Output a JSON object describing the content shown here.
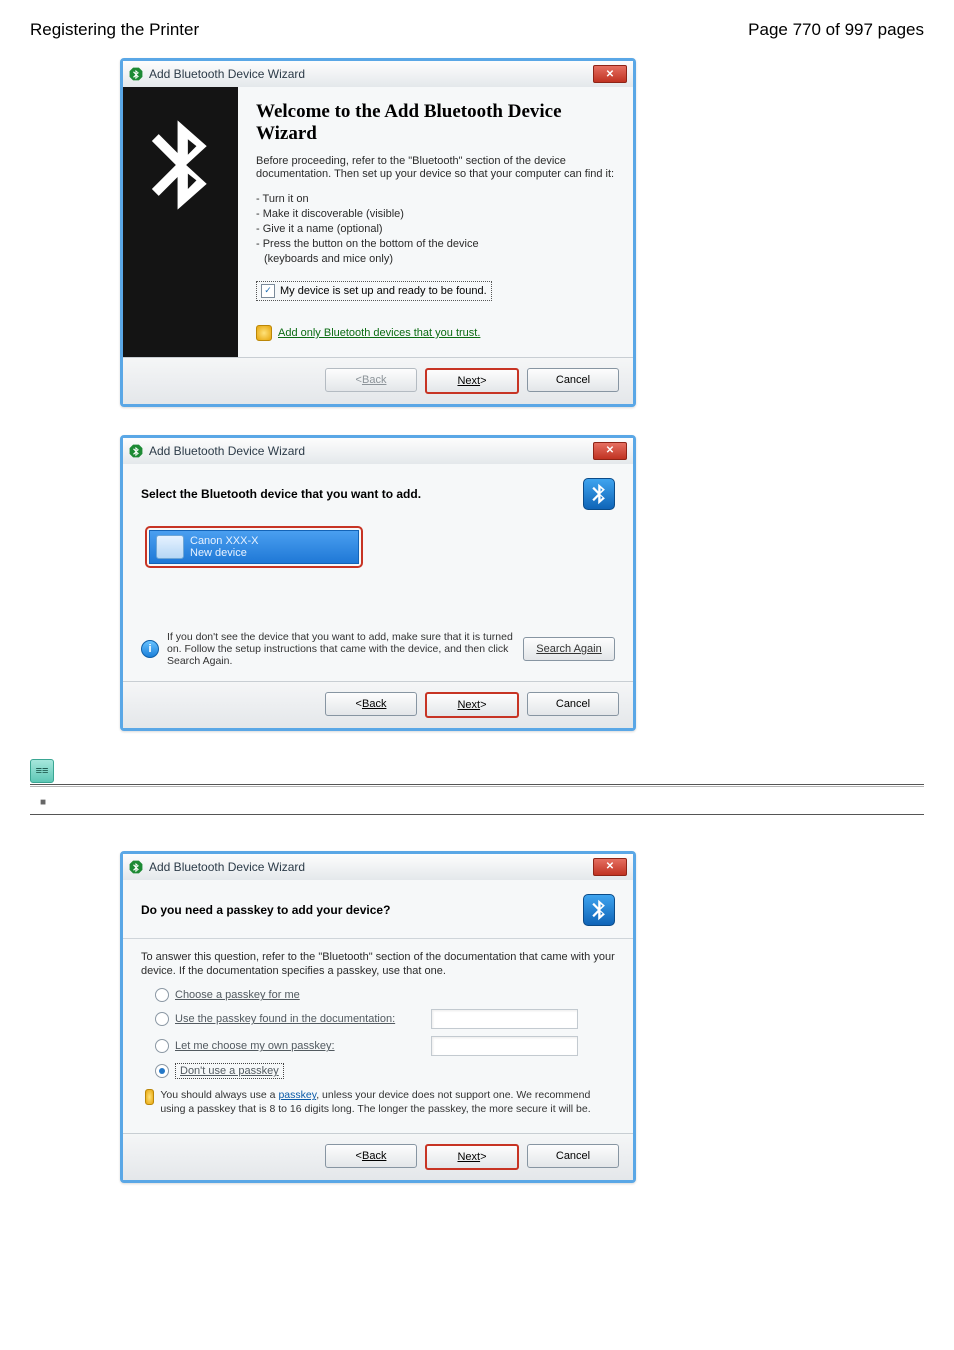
{
  "page": {
    "title": "Registering the Printer",
    "indicator": "Page 770 of 997 pages"
  },
  "buttons": {
    "back": "Back",
    "next": "Next",
    "cancel": "Cancel"
  },
  "step1": {
    "window_title": "Add Bluetooth Device Wizard",
    "heading": "Welcome to the Add Bluetooth Device Wizard",
    "intro": "Before proceeding, refer to the \"Bluetooth\" section of the device documentation. Then set up your device so that your computer can find it:",
    "bullets": [
      "- Turn it on",
      "- Make it discoverable (visible)",
      "- Give it a name (optional)",
      "- Press the button on the bottom of the device",
      "(keyboards and mice only)"
    ],
    "checkbox_label": "My device is set up and ready to be found.",
    "trust_link": "Add only Bluetooth devices that you trust."
  },
  "step2": {
    "window_title": "Add Bluetooth Device Wizard",
    "heading": "Select the Bluetooth device that you want to add.",
    "device": {
      "name": "Canon XXX-X",
      "status": "New device"
    },
    "info": "If you don't see the device that you want to add, make sure that it is turned on. Follow the setup instructions that came with the device, and then click Search Again.",
    "search_again": "Search Again"
  },
  "step3": {
    "window_title": "Add Bluetooth Device Wizard",
    "heading": "Do you need a passkey to add your device?",
    "intro": "To answer this question, refer to the \"Bluetooth\" section of the documentation that came with your device. If the documentation specifies a passkey, use that one.",
    "options": [
      "Choose a passkey for me",
      "Use the passkey found in the documentation:",
      "Let me choose my own passkey:",
      "Don't use a passkey"
    ],
    "warn": {
      "a": "You should always use a ",
      "link": "passkey",
      "b": ", unless your device does not support one. We recommend using a passkey that is 8 to 16 digits long. The longer the passkey, the more secure it will be."
    }
  }
}
